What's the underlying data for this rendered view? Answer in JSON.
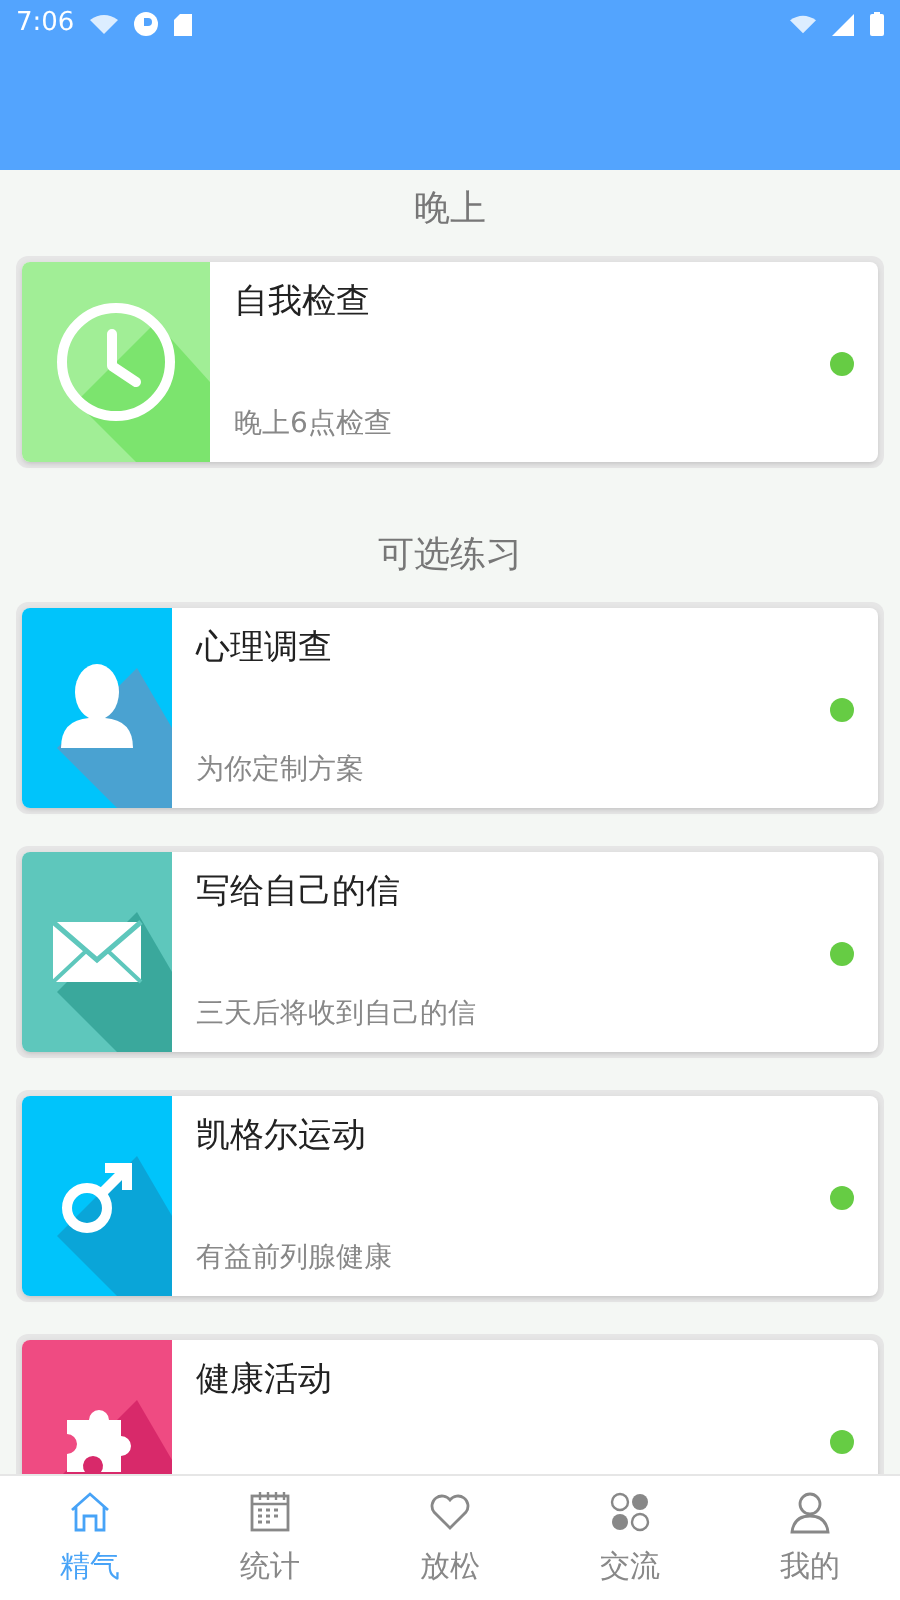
{
  "status_bar": {
    "time": "7:06"
  },
  "sections": [
    {
      "title": "晚上",
      "cards": [
        {
          "title": "自我检查",
          "subtitle": "晚上6点检查",
          "color": "#a1ee96"
        }
      ]
    },
    {
      "title": "可选练习",
      "cards": [
        {
          "title": "心理调查",
          "subtitle": "为你定制方案",
          "color": "#00c4fb"
        },
        {
          "title": "写给自己的信",
          "subtitle": "三天后将收到自己的信",
          "color": "#5ec7bc"
        },
        {
          "title": "凯格尔运动",
          "subtitle": "有益前列腺健康",
          "color": "#00c4fb"
        },
        {
          "title": "健康活动",
          "color": "#ef4b82"
        }
      ]
    }
  ],
  "bottom_nav": [
    {
      "label": "精气",
      "selected": true
    },
    {
      "label": "统计",
      "selected": false
    },
    {
      "label": "放松",
      "selected": false
    },
    {
      "label": "交流",
      "selected": false
    },
    {
      "label": "我的",
      "selected": false
    }
  ]
}
